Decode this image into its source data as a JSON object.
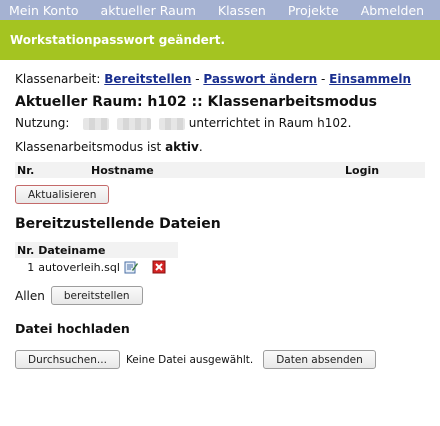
{
  "nav": {
    "items": [
      "Mein Konto",
      "aktueller Raum",
      "Klassen",
      "Projekte",
      "Abmelden"
    ]
  },
  "flash": {
    "message": "Workstationpasswort geändert."
  },
  "exam": {
    "label": "Klassenarbeit:",
    "link_provide": "Bereitstellen",
    "sep1": " - ",
    "link_password": "Passwort ändern",
    "sep2": " - ",
    "link_collect": "Einsammeln"
  },
  "room": {
    "title": "Aktueller Raum: h102 :: Klassenarbeitsmodus",
    "usage_label": "Nutzung:",
    "usage_text": "unterrichtet in Raum h102.",
    "mode_text": "Klassenarbeitsmodus ist ",
    "mode_value": "aktiv",
    "mode_end": "."
  },
  "clients_table": {
    "headers": [
      "Nr.",
      "Hostname",
      "Login"
    ]
  },
  "refresh_button": "Aktualisieren",
  "files": {
    "heading": "Bereitzustellende Dateien",
    "headers": [
      "Nr.",
      "Dateiname"
    ],
    "rows": [
      {
        "nr": "1",
        "name": "autoverleih.sql"
      }
    ]
  },
  "all": {
    "label": "Allen",
    "button": "bereitstellen"
  },
  "upload": {
    "heading": "Datei hochladen",
    "browse": "Durchsuchen...",
    "no_file": "Keine Datei ausgewählt.",
    "submit": "Daten absenden"
  },
  "colors": {
    "nav": "#a5b2d2",
    "flash": "#a4c421",
    "link": "#1a2f8f"
  },
  "icons": [
    "edit-icon",
    "delete-icon"
  ]
}
